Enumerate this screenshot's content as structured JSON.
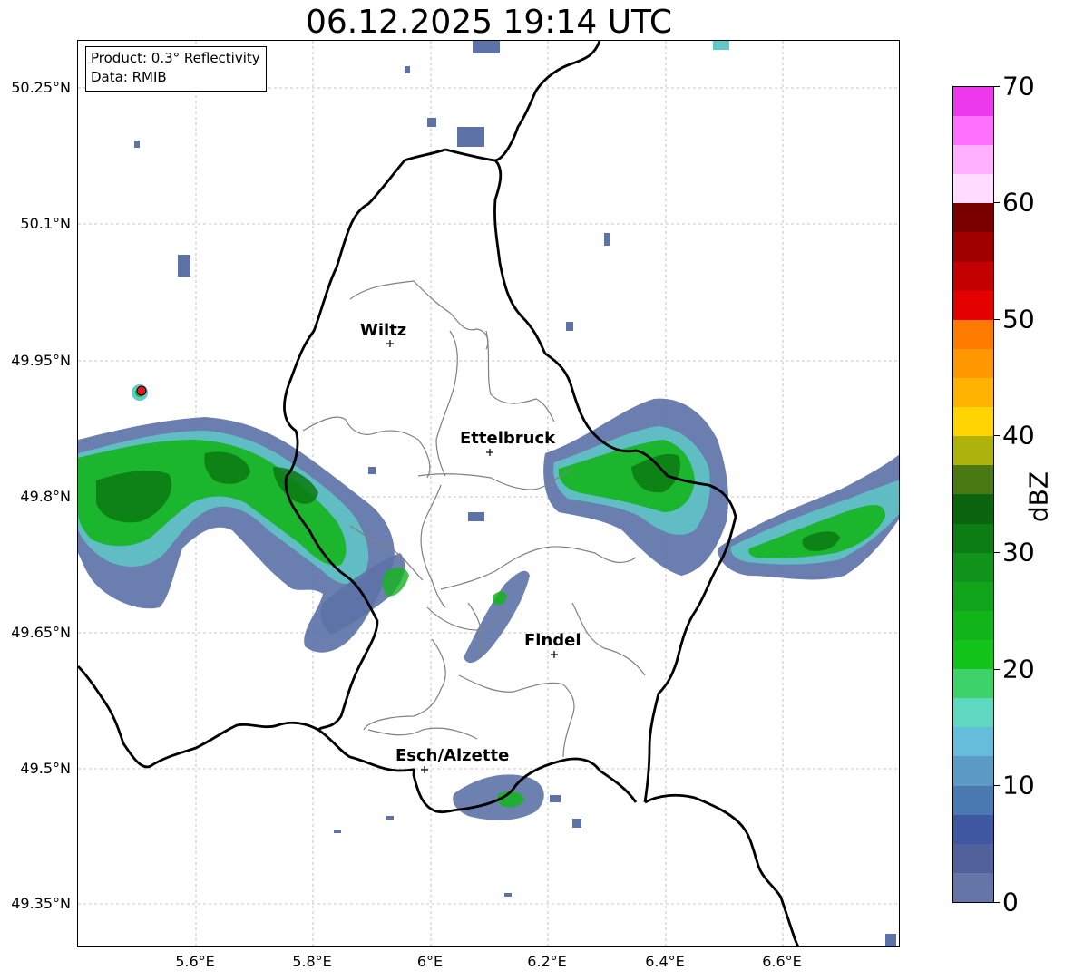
{
  "title": "06.12.2025 19:14 UTC",
  "info": {
    "product": "Product: 0.3° Reflectivity",
    "data": "Data: RMIB"
  },
  "axes": {
    "lat_ticks": [
      "50.25°N",
      "50.1°N",
      "49.95°N",
      "49.8°N",
      "49.65°N",
      "49.5°N",
      "49.35°N"
    ],
    "lon_ticks": [
      "5.6°E",
      "5.8°E",
      "6°E",
      "6.2°E",
      "6.4°E",
      "6.6°E"
    ]
  },
  "cities": {
    "wiltz": "Wiltz",
    "ettelbruck": "Ettelbruck",
    "findel": "Findel",
    "esch": "Esch/Alzette"
  },
  "colorbar": {
    "label": "dBZ",
    "ticks": [
      "0",
      "10",
      "20",
      "30",
      "40",
      "50",
      "60",
      "70"
    ],
    "colors": [
      "#6675a8",
      "#52619c",
      "#3f57a0",
      "#4a78b0",
      "#5b9bc4",
      "#66bddb",
      "#5fd8c2",
      "#3ed36a",
      "#12c41a",
      "#11b51a",
      "#10a41a",
      "#0f931a",
      "#0c7d14",
      "#0b6510",
      "#4a7812",
      "#adb30a",
      "#ffd400",
      "#ffb200",
      "#ff9800",
      "#ff7b00",
      "#e40000",
      "#c40000",
      "#a00000",
      "#7a0000",
      "#ffdcff",
      "#ffb0ff",
      "#ff70ff",
      "#ee38ee"
    ]
  },
  "colors": {
    "echo_low": "#5d73a8",
    "echo_mid": "#5fc8c8",
    "echo_green": "#14b41e",
    "echo_dark": "#0b7a12",
    "border": "#000000",
    "canton": "#808080",
    "radar_marker": "#e11b1b"
  }
}
